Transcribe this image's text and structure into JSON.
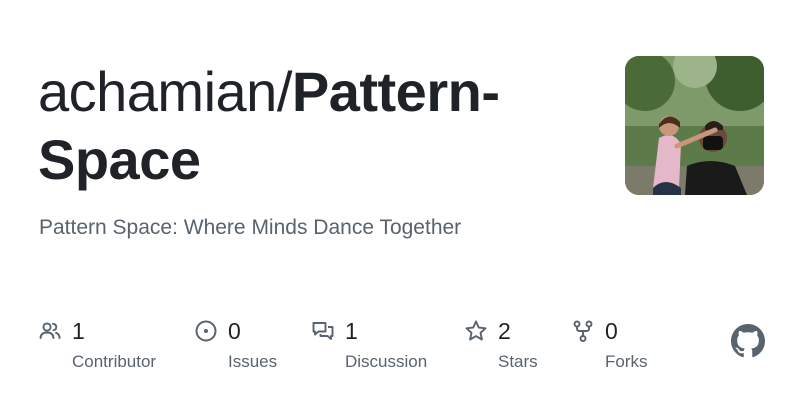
{
  "repo": {
    "owner": "achamian/",
    "name": "Pattern-Space",
    "description": "Pattern Space: Where Minds Dance Together"
  },
  "avatar": {
    "icon": "user-avatar-photo"
  },
  "stats": {
    "contributors": {
      "count": "1",
      "label": "Contributor",
      "icon": "people-icon"
    },
    "issues": {
      "count": "0",
      "label": "Issues",
      "icon": "issue-opened-icon"
    },
    "discussions": {
      "count": "1",
      "label": "Discussion",
      "icon": "discussion-icon"
    },
    "stars": {
      "count": "2",
      "label": "Stars",
      "icon": "star-icon"
    },
    "forks": {
      "count": "0",
      "label": "Forks",
      "icon": "fork-icon"
    }
  },
  "brand": {
    "icon": "github-logo-icon",
    "muted_color": "#59636e",
    "text_color": "#1f2328"
  }
}
